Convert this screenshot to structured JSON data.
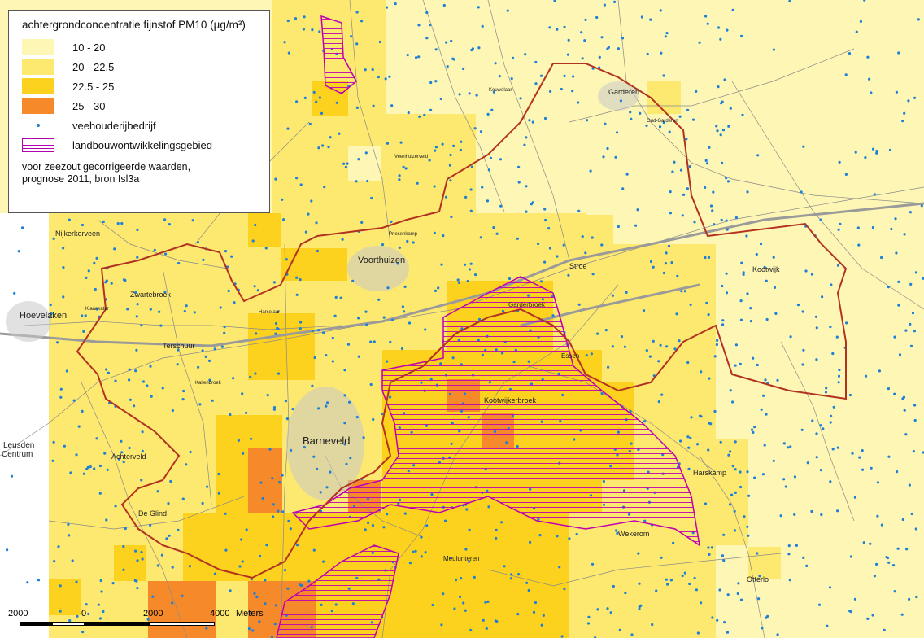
{
  "legend": {
    "title": "achtergrondconcentratie fijnstof PM10 (µg/m³)",
    "classes": [
      {
        "label": "10 - 20",
        "color": "#fef6b4"
      },
      {
        "label": "20 - 22.5",
        "color": "#fde870"
      },
      {
        "label": "22.5 - 25",
        "color": "#fcd21e"
      },
      {
        "label": "25 - 30",
        "color": "#f68a2a"
      }
    ],
    "farm_label": "veehouderijbedrijf",
    "farm_color": "#1e7fd8",
    "zone_label": "landbouwontwikkelingsgebied",
    "zone_color": "#b000b0",
    "boundary_color": "#b23222",
    "note_line1": "voor zeezout gecorrigeerde waarden,",
    "note_line2": "prognose 2011, bron Isl3a"
  },
  "places": {
    "barneveld": "Barneveld",
    "voorthuizen": "Voorthuizen",
    "hoevelaken": "Hoevelaken",
    "nijkerkerveen": "Nijkerkerveen",
    "zwartebroek": "Zwartebroek",
    "terschuur": "Terschuur",
    "achterveld": "Achterveld",
    "de_glind": "De Glind",
    "stroe": "Stroe",
    "garderbroek": "Garderbroek",
    "essen": "Essen",
    "kootwijkerbroek": "Kootwijkerbroek",
    "kootwijk": "Kootwijk",
    "harskamp": "Harskamp",
    "wekerom": "Wekerom",
    "otterlo": "Otterlo",
    "meulunteren": "Meulunteren",
    "garderen": "Garderen",
    "oud_garderen": "Oud-Garderen",
    "kouwelaar": "Kouwelaar",
    "veenhuizerveld": "Veenhuizerveld",
    "priesenkamp": "Priesenkamp",
    "klaarwater": "Klaarwater",
    "harselaar": "Harselaar",
    "kallenbroek": "Kallenbroek",
    "leusden": "Leusden",
    "centrum": "Centrum"
  },
  "scale": {
    "left": "2000",
    "zero": "0",
    "mid": "2000",
    "right": "4000",
    "unit": "Meters"
  }
}
